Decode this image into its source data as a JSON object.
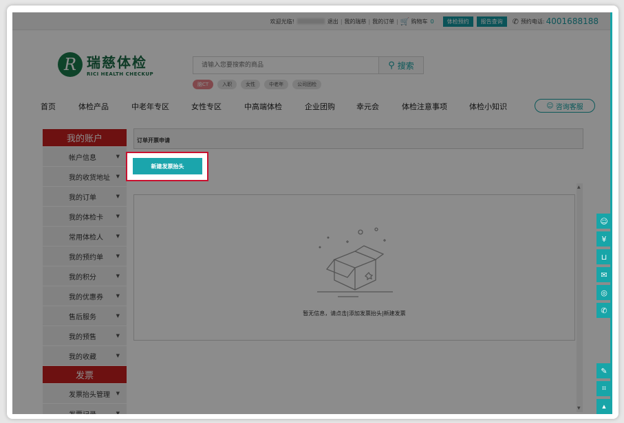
{
  "topbar": {
    "welcome": "欢迎光临!",
    "logout": "退出",
    "my_ruici": "我的瑞慈",
    "my_orders": "我的订单",
    "cart_label": "购物车",
    "cart_count": "0",
    "btn_book": "体检预约",
    "btn_report": "报告查询",
    "phone_label": "预约电话:",
    "phone_number": "4001688188"
  },
  "logo": {
    "cn": "瑞慈体检",
    "en": "RICI HEALTH CHECKUP",
    "mark": "R"
  },
  "search": {
    "placeholder": "请输入您要搜索的商品",
    "button": "搜索"
  },
  "tags": [
    "脑CT",
    "入职",
    "女性",
    "中老年",
    "公司团检"
  ],
  "nav": [
    "首页",
    "体检产品",
    "中老年专区",
    "女性专区",
    "中高端体检",
    "企业团购",
    "幸元会",
    "体检注意事项",
    "体检小知识"
  ],
  "consult": "咨询客服",
  "sidebar": {
    "account_title": "我的账户",
    "account_items": [
      "帐户信息",
      "我的收货地址",
      "我的订单",
      "我的体检卡",
      "常用体检人",
      "我的预约单",
      "我的积分",
      "我的优惠券",
      "售后服务",
      "我的预售",
      "我的收藏"
    ],
    "invoice_title": "发票",
    "invoice_items": [
      "发票抬头管理",
      "发票记录"
    ]
  },
  "content": {
    "crumb": "订单开票申请",
    "new_button": "新建发票抬头",
    "empty_text": "暂无信息，请点击|添加发票抬头|新建发票"
  },
  "colors": {
    "teal": "#18a5a8",
    "red": "#c71f1f",
    "highlight": "#c8102e"
  }
}
